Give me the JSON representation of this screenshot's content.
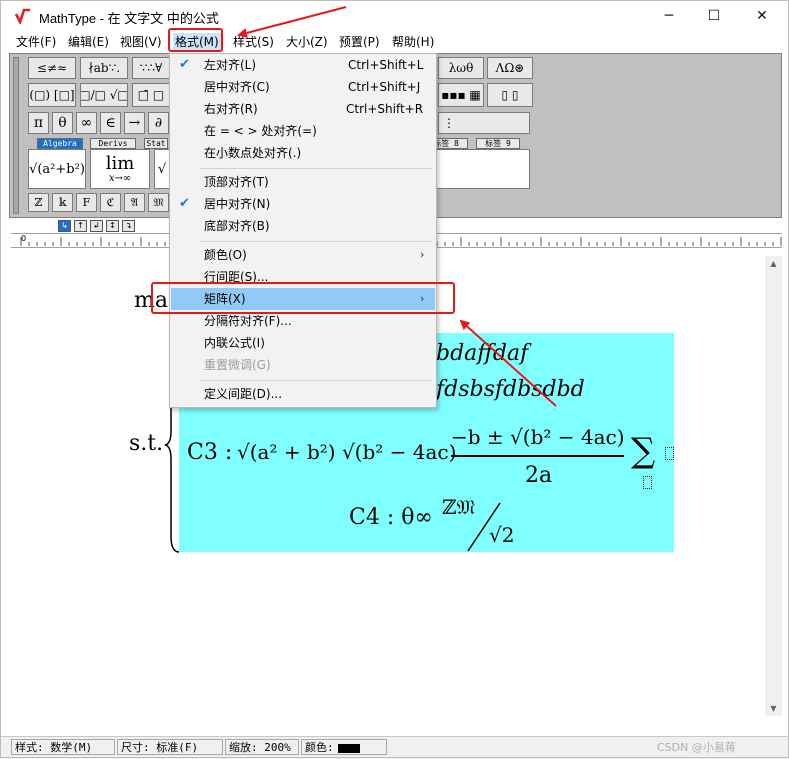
{
  "window": {
    "title": "MathType - 在 文字文 中的公式",
    "controls": {
      "minimize": "─",
      "maximize": "☐",
      "close": "✕"
    }
  },
  "menubar": [
    {
      "label": "文件(F)"
    },
    {
      "label": "编辑(E)"
    },
    {
      "label": "视图(V)"
    },
    {
      "label": "格式(M)"
    },
    {
      "label": "样式(S)"
    },
    {
      "label": "大小(Z)"
    },
    {
      "label": "预置(P)"
    },
    {
      "label": "帮助(H)"
    }
  ],
  "toolbar": {
    "row1": [
      "≤≠≈",
      "∤ab∵.",
      "∵∴∀",
      "λωθ",
      "ΛΩ⊛"
    ],
    "row2": [
      "(□) [□]",
      "□/□ √□",
      "□̄ □",
      "▪▪▪ ▦",
      "▯ ▯"
    ],
    "row3": [
      "π",
      "θ",
      "∞",
      "∈",
      "→",
      "∂"
    ],
    "row3_right": [
      "⋮"
    ],
    "tabs": [
      "Algebra",
      "Derivs",
      "Stat",
      "标签 8",
      "标签 9"
    ],
    "templates": [
      "√(a²+b²)",
      "lim",
      "x→∞",
      "√"
    ],
    "row5": [
      "ℤ",
      "𝕜",
      "F",
      "ℭ",
      "𝔄",
      "𝔐"
    ]
  },
  "ruler": {
    "zero": "0"
  },
  "document": {
    "max_prefix": "ma",
    "line1_tail": "bdaffdaf",
    "line2_tail": "fdsbsfdbsdbd",
    "st_label": "s.t.",
    "c3_prefix": "C3 :",
    "c3_tail": "√(a² + b²) √(b² − 4ac)",
    "frac_num": "−b ± √(b² − 4ac)",
    "frac_den": "2a",
    "sum": "∑",
    "c4_prefix": "C4 : θ∞",
    "c4_num": "ℤ𝔐",
    "c4_den": "√2"
  },
  "format_menu": {
    "items": [
      {
        "label": "左对齐(L)",
        "shortcut": "Ctrl+Shift+L",
        "checked": true
      },
      {
        "label": "居中对齐(C)",
        "shortcut": "Ctrl+Shift+J"
      },
      {
        "label": "右对齐(R)",
        "shortcut": "Ctrl+Shift+R"
      },
      {
        "label": "在 = < > 处对齐(=)"
      },
      {
        "label": "在小数点处对齐(.)"
      },
      {
        "label": "顶部对齐(T)"
      },
      {
        "label": "居中对齐(N)",
        "checked": true
      },
      {
        "label": "底部对齐(B)"
      },
      {
        "label": "颜色(O)",
        "submenu": true
      },
      {
        "label": "行间距(S)..."
      },
      {
        "label": "矩阵(X)",
        "submenu": true,
        "highlighted": true
      },
      {
        "label": "分隔符对齐(F)..."
      },
      {
        "label": "内联公式(I)"
      },
      {
        "label": "重置微调(G)",
        "disabled": true
      },
      {
        "label": "定义间距(D)..."
      }
    ]
  },
  "statusbar": {
    "style": "样式: 数学(M)",
    "size": "尺寸: 标准(F)",
    "zoom": "缩放: 200%",
    "color": "颜色:"
  },
  "watermark": "CSDN @小易蒋",
  "colors": {
    "equation_highlight": "#80ffff",
    "menu_highlight": "#91c9f7",
    "annotation_red": "#e8181a",
    "check_blue": "#2074d8"
  }
}
